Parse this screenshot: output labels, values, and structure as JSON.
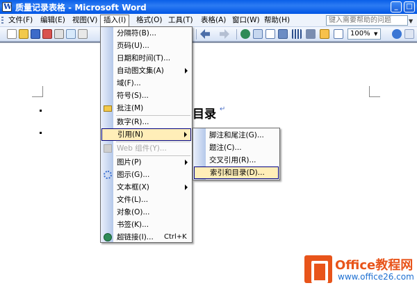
{
  "window": {
    "title": "质量记录表格 - Microsoft Word",
    "buttons": [
      "_",
      "□"
    ]
  },
  "menubar": {
    "items": [
      "文件(F)",
      "编辑(E)",
      "视图(V)",
      "插入(I)",
      "格式(O)",
      "工具(T)",
      "表格(A)",
      "窗口(W)",
      "帮助(H)"
    ],
    "active_index": 3,
    "help_placeholder": "键入需要帮助的问题"
  },
  "toolbar": {
    "zoom": "100%"
  },
  "document": {
    "heading": "目录",
    "para_mark": "↵"
  },
  "insert_menu": {
    "items": [
      {
        "label": "分隔符(B)...",
        "submenu": false
      },
      {
        "label": "页码(U)...",
        "submenu": false
      },
      {
        "label": "日期和时间(T)...",
        "submenu": false
      },
      {
        "label": "自动图文集(A)",
        "submenu": true
      },
      {
        "label": "域(F)...",
        "submenu": false
      },
      {
        "label": "符号(S)...",
        "submenu": false
      },
      {
        "label": "批注(M)",
        "submenu": false,
        "icon": "folder-icon"
      },
      {
        "label": "数字(R)...",
        "submenu": false
      },
      {
        "label": "引用(N)",
        "submenu": true,
        "highlighted": true
      },
      {
        "label": "Web 组件(Y)...",
        "submenu": false,
        "disabled": true,
        "icon": "web-component-icon"
      },
      {
        "label": "图片(P)",
        "submenu": true
      },
      {
        "label": "图示(G)...",
        "submenu": false,
        "icon": "diagram-icon"
      },
      {
        "label": "文本框(X)",
        "submenu": true
      },
      {
        "label": "文件(L)...",
        "submenu": false
      },
      {
        "label": "对象(O)...",
        "submenu": false
      },
      {
        "label": "书签(K)...",
        "submenu": false
      },
      {
        "label": "超链接(I)...",
        "shortcut": "Ctrl+K",
        "submenu": false,
        "icon": "hyperlink-icon"
      }
    ]
  },
  "reference_submenu": {
    "items": [
      {
        "label": "脚注和尾注(G)..."
      },
      {
        "label": "题注(C)..."
      },
      {
        "label": "交叉引用(R)..."
      },
      {
        "label": "索引和目录(D)...",
        "highlighted": true
      }
    ]
  },
  "watermark": {
    "brand": "Office教程网",
    "url": "www.office26.com"
  },
  "colors": {
    "titlebar": "#0a5fe8",
    "highlight": "#ffeeb8",
    "logo": "#e8541a"
  }
}
